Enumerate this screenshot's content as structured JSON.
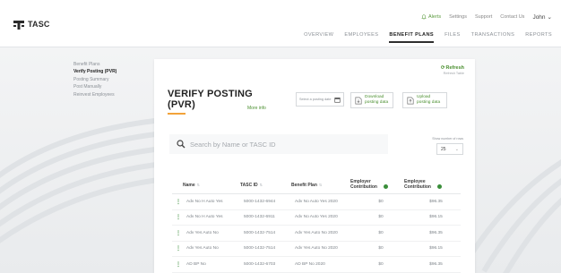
{
  "brand": {
    "logo_text": "TASC"
  },
  "utility_nav": {
    "alerts": "Alerts",
    "settings": "Settings",
    "support": "Support",
    "contact": "Contact Us",
    "user": "John"
  },
  "main_nav": [
    "OVERVIEW",
    "EMPLOYEES",
    "BENEFIT PLANS",
    "FILES",
    "TRANSACTIONS",
    "REPORTS"
  ],
  "main_nav_active": "BENEFIT PLANS",
  "side_menu": [
    {
      "label": "Benefit Plans",
      "active": false
    },
    {
      "label": "Verify Posting (PVR)",
      "active": true
    },
    {
      "label": "Posting Summary",
      "active": false
    },
    {
      "label": "Post Manually",
      "active": false
    },
    {
      "label": "Reinvest Employees",
      "active": false
    }
  ],
  "page": {
    "title": "VERIFY POSTING (PVR)",
    "more_info": "More info",
    "refresh": "Refresh",
    "refresh_sub": "Refresh Table",
    "date_placeholder": "Select a posting date",
    "download_label": "Download posting data",
    "upload_label": "Upload posting data",
    "search_placeholder": "Search by Name or TASC ID",
    "show_count_label": "Show number of rows",
    "show_count_value": "25"
  },
  "table": {
    "headers": [
      "Name",
      "TASC ID",
      "Benefit Plan",
      "Employer Contribution",
      "Employee Contribution"
    ],
    "rows": [
      {
        "name": "Adv No H Auto Yes",
        "id": "5000-1432-6944",
        "plan": "Adv No Auto Yes 2020",
        "employer": "$0",
        "employee": "$96.35"
      },
      {
        "name": "Adv No H Auto Yes",
        "id": "5000-1432-6911",
        "plan": "Adv No Auto Yes 2020",
        "employer": "$0",
        "employee": "$96.15"
      },
      {
        "name": "Adv Yes Auto No",
        "id": "5000-1432-7514",
        "plan": "Adv Yes Auto No 2020",
        "employer": "$0",
        "employee": "$96.35"
      },
      {
        "name": "Adv Yes Auto No",
        "id": "5000-1432-7514",
        "plan": "Adv Yes Auto No 2020",
        "employer": "$0",
        "employee": "$96.15"
      },
      {
        "name": "AD BP No",
        "id": "5000-1432-6703",
        "plan": "AD BP No 2020",
        "employer": "$0",
        "employee": "$96.35"
      }
    ]
  },
  "colors": {
    "accent_green": "#4a8f2f",
    "title_underline": "#f2a33a"
  }
}
